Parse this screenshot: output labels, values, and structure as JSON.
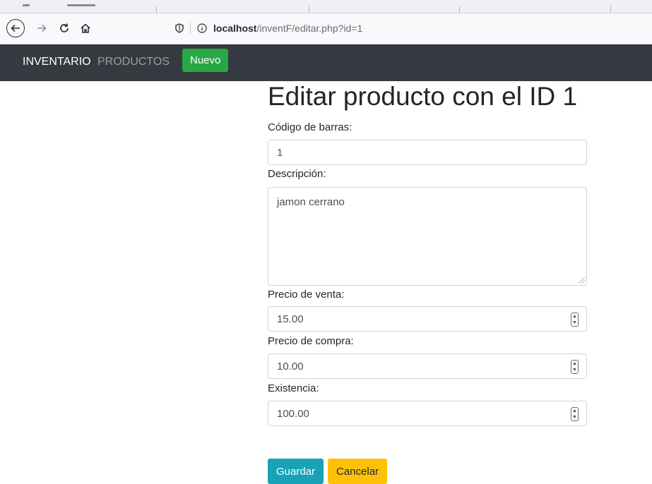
{
  "browser": {
    "url_host": "localhost",
    "url_path": "/inventF/editar.php?id=1",
    "back_icon": "arrow-left-icon",
    "forward_icon": "arrow-right-icon",
    "reload_icon": "reload-icon",
    "home_icon": "home-icon"
  },
  "navbar": {
    "brand": "INVENTARIO",
    "link_products": "PRODUCTOS",
    "new_button": "Nuevo",
    "colors": {
      "background": "#343a40",
      "new_button": "#28a745"
    }
  },
  "form": {
    "title": "Editar producto con el ID 1",
    "barcode_label": "Código de barras:",
    "barcode_value": "1",
    "description_label": "Descripción:",
    "description_value": "jamon cerrano",
    "sale_price_label": "Precio de venta:",
    "sale_price_value": "15.00",
    "purchase_price_label": "Precio de compra:",
    "purchase_price_value": "10.00",
    "stock_label": "Existencia:",
    "stock_value": "100.00",
    "save_button": "Guardar",
    "cancel_button": "Cancelar",
    "colors": {
      "save": "#17a2b8",
      "cancel": "#ffc107"
    }
  }
}
